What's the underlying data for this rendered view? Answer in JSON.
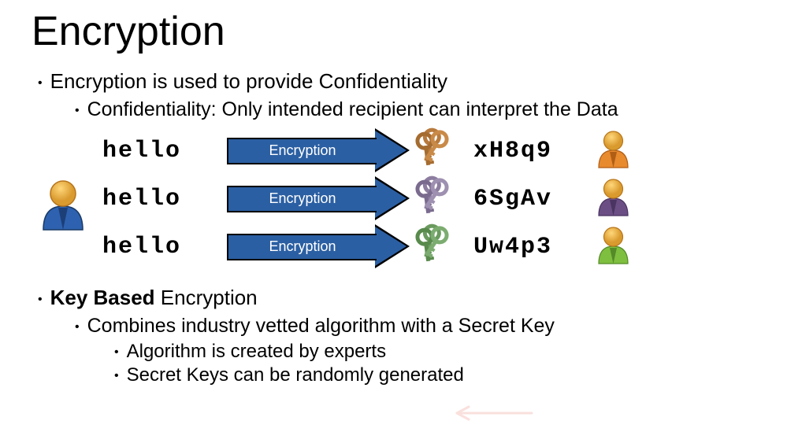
{
  "title": "Encryption",
  "bullets": {
    "b1": "Encryption is used to provide Confidentiality",
    "b1_1": "Confidentiality:  Only intended recipient can interpret the Data",
    "b2_bold": "Key Based",
    "b2_rest": " Encryption",
    "b2_1": "Combines industry vetted algorithm with a Secret Key",
    "b2_1_1": "Algorithm is created by experts",
    "b2_1_2": "Secret Keys can be randomly generated"
  },
  "diagram": {
    "arrow_label": "Encryption",
    "rows": [
      {
        "plain": "hello",
        "cipher": "xH8q9",
        "key_color": "#b87a3c",
        "person_body": "#e88a2e",
        "person_tie": "#b05e15"
      },
      {
        "plain": "hello",
        "cipher": "6SgAv",
        "key_color": "#8c7da0",
        "person_body": "#6b4f84",
        "person_tie": "#4a3461"
      },
      {
        "plain": "hello",
        "cipher": "Uw4p3",
        "key_color": "#6a9a5e",
        "person_body": "#7fbf3f",
        "person_tie": "#558a28"
      }
    ],
    "sender": {
      "body": "#2e62b0",
      "tie": "#1c3f78"
    }
  }
}
